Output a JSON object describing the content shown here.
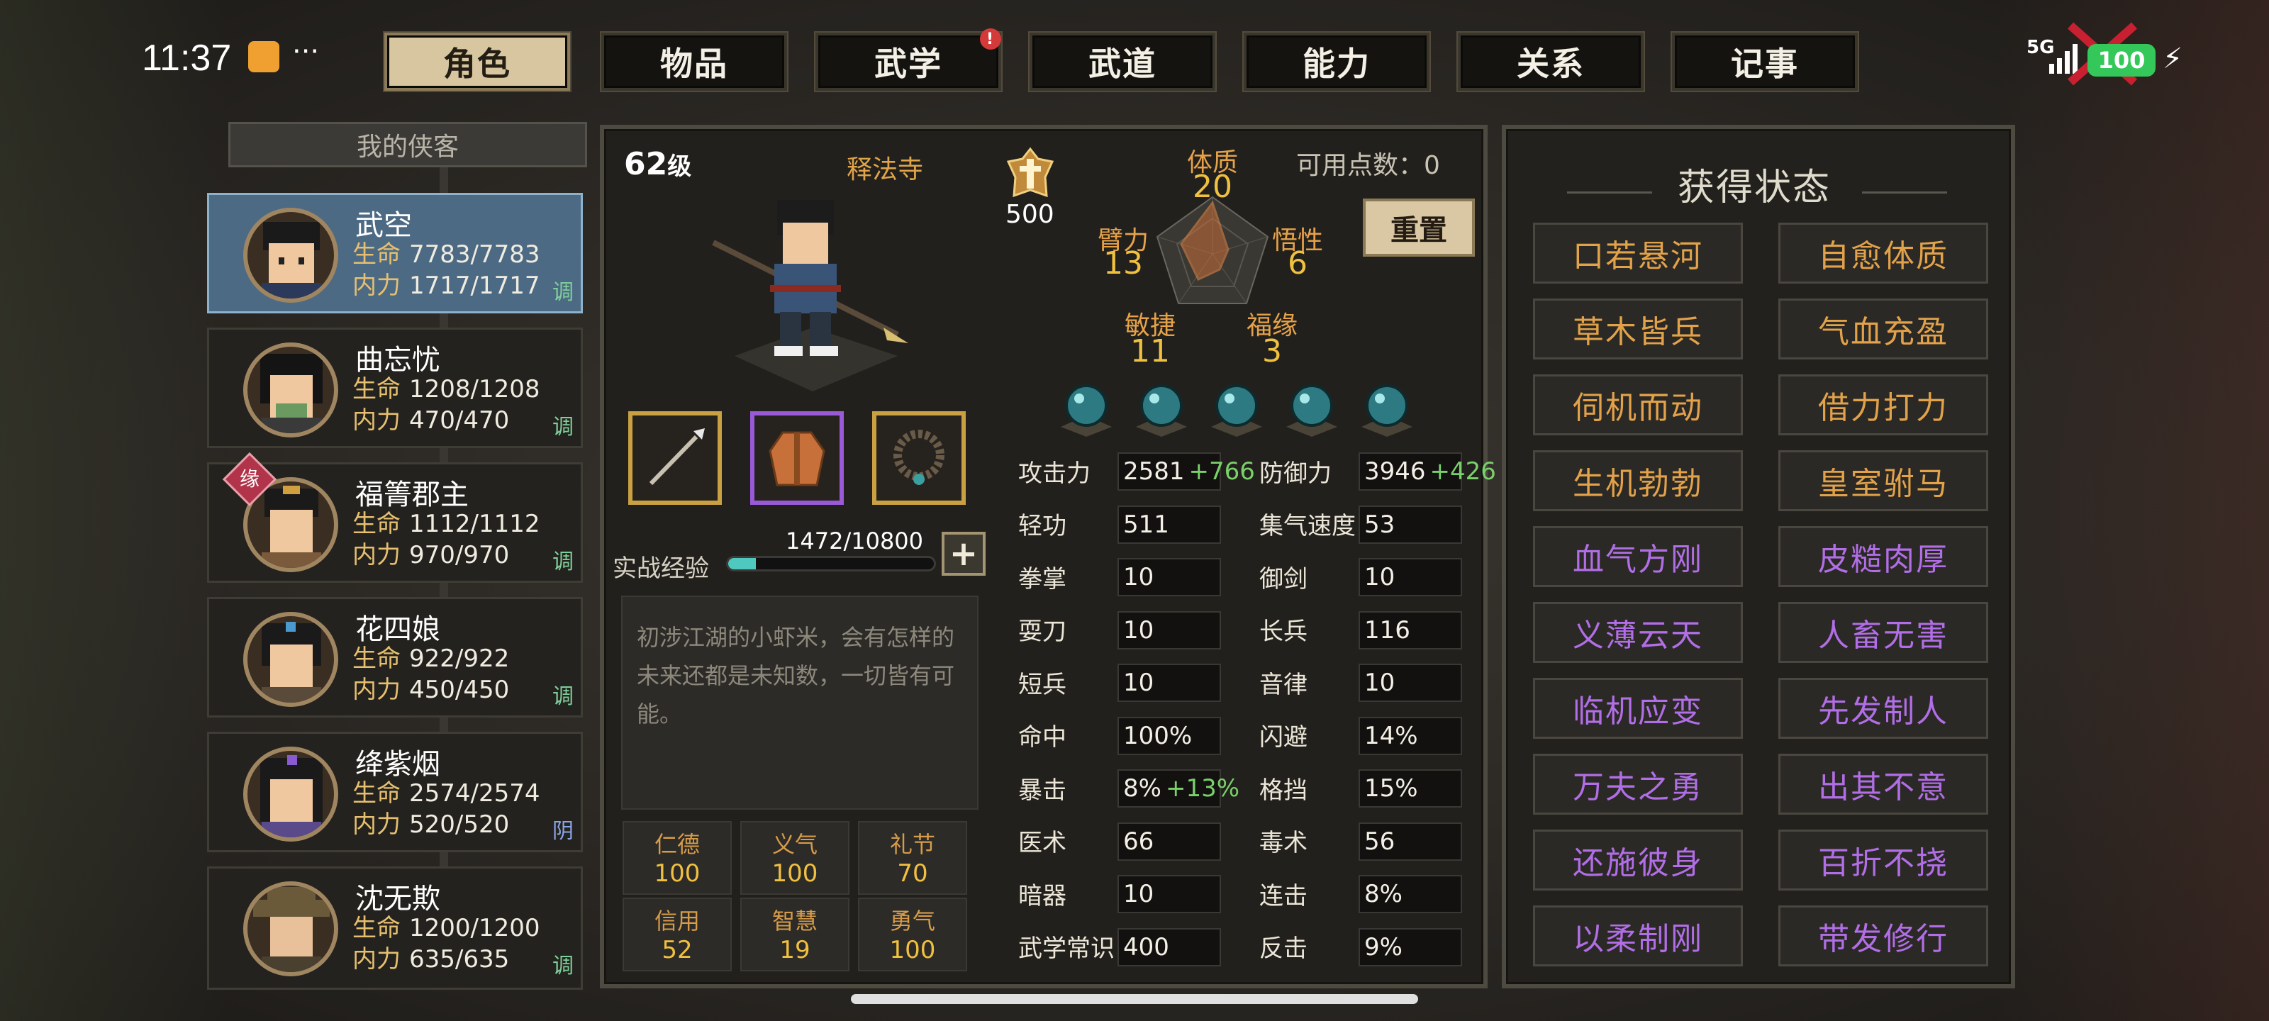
{
  "status_bar": {
    "time": "11:37",
    "network": "5G",
    "battery": "100"
  },
  "tabs": [
    {
      "label": "角色",
      "active": true
    },
    {
      "label": "物品"
    },
    {
      "label": "武学",
      "badge": "!"
    },
    {
      "label": "武道"
    },
    {
      "label": "能力"
    },
    {
      "label": "关系"
    },
    {
      "label": "记事"
    }
  ],
  "roster": {
    "title": "我的侠客",
    "hp_label": "生命",
    "mp_label": "内力",
    "heroes": [
      {
        "name": "武空",
        "hp": "7783/7783",
        "mp": "1717/1717",
        "tag": "调",
        "selected": true
      },
      {
        "name": "曲忘忧",
        "hp": "1208/1208",
        "mp": "470/470",
        "tag": "调"
      },
      {
        "name": "福箐郡主",
        "hp": "1112/1112",
        "mp": "970/970",
        "tag": "调",
        "mark": "缘"
      },
      {
        "name": "花四娘",
        "hp": "922/922",
        "mp": "450/450",
        "tag": "调"
      },
      {
        "name": "绛紫烟",
        "hp": "2574/2574",
        "mp": "520/520",
        "tag": "阴"
      },
      {
        "name": "沈无欺",
        "hp": "1200/1200",
        "mp": "635/635",
        "tag": "调"
      }
    ]
  },
  "character": {
    "level": "62",
    "level_suffix": "级",
    "sect": "释法寺",
    "rank_value": "500",
    "available_points": "可用点数：0",
    "reset_label": "重置",
    "attributes": {
      "tizhi": {
        "label": "体质",
        "value": "20"
      },
      "bili": {
        "label": "臂力",
        "value": "13"
      },
      "wuxing": {
        "label": "悟性",
        "value": "6"
      },
      "minjie": {
        "label": "敏捷",
        "value": "11"
      },
      "fuyuan": {
        "label": "福缘",
        "value": "3"
      }
    },
    "exp_label": "实战经验",
    "exp_text": "1472/10800",
    "exp_progress": 0.136,
    "description": "初涉江湖的小虾米，会有怎样的未来还都是未知数，一切皆有可能。",
    "virtues": [
      {
        "label": "仁德",
        "value": "100"
      },
      {
        "label": "义气",
        "value": "100"
      },
      {
        "label": "礼节",
        "value": "70"
      },
      {
        "label": "信用",
        "value": "52"
      },
      {
        "label": "智慧",
        "value": "19"
      },
      {
        "label": "勇气",
        "value": "100"
      }
    ]
  },
  "stats_left": [
    {
      "label": "攻击力",
      "value": "2581",
      "bonus": "+766"
    },
    {
      "label": "轻功",
      "value": "511"
    },
    {
      "label": "拳掌",
      "value": "10"
    },
    {
      "label": "耍刀",
      "value": "10"
    },
    {
      "label": "短兵",
      "value": "10"
    },
    {
      "label": "命中",
      "value": "100%"
    },
    {
      "label": "暴击",
      "value": "8%",
      "bonus": "+13%"
    },
    {
      "label": "医术",
      "value": "66"
    },
    {
      "label": "暗器",
      "value": "10"
    },
    {
      "label": "武学常识",
      "value": "400"
    }
  ],
  "stats_right": [
    {
      "label": "防御力",
      "value": "3946",
      "bonus": "+426"
    },
    {
      "label": "集气速度",
      "value": "53"
    },
    {
      "label": "御剑",
      "value": "10"
    },
    {
      "label": "长兵",
      "value": "116"
    },
    {
      "label": "音律",
      "value": "10"
    },
    {
      "label": "闪避",
      "value": "14%"
    },
    {
      "label": "格挡",
      "value": "15%"
    },
    {
      "label": "毒术",
      "value": "56"
    },
    {
      "label": "连击",
      "value": "8%"
    },
    {
      "label": "反击",
      "value": "9%"
    }
  ],
  "status_panel": {
    "title": "获得状态",
    "buffs": [
      {
        "label": "口若悬河",
        "color": "gold"
      },
      {
        "label": "自愈体质",
        "color": "gold"
      },
      {
        "label": "草木皆兵",
        "color": "gold"
      },
      {
        "label": "气血充盈",
        "color": "gold"
      },
      {
        "label": "伺机而动",
        "color": "gold"
      },
      {
        "label": "借力打力",
        "color": "gold"
      },
      {
        "label": "生机勃勃",
        "color": "gold"
      },
      {
        "label": "皇室驸马",
        "color": "gold"
      },
      {
        "label": "血气方刚",
        "color": "purple"
      },
      {
        "label": "皮糙肉厚",
        "color": "purple"
      },
      {
        "label": "义薄云天",
        "color": "purple"
      },
      {
        "label": "人畜无害",
        "color": "purple"
      },
      {
        "label": "临机应变",
        "color": "purple"
      },
      {
        "label": "先发制人",
        "color": "purple"
      },
      {
        "label": "万夫之勇",
        "color": "purple"
      },
      {
        "label": "出其不意",
        "color": "purple"
      },
      {
        "label": "还施彼身",
        "color": "purple"
      },
      {
        "label": "百折不挠",
        "color": "purple"
      },
      {
        "label": "以柔制刚",
        "color": "purple"
      },
      {
        "label": "带发修行",
        "color": "purple"
      }
    ]
  }
}
